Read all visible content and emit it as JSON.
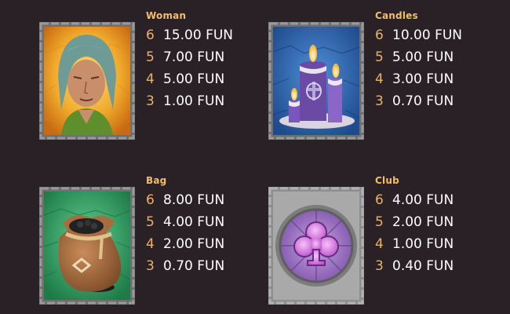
{
  "paytable": {
    "symbols": [
      {
        "name": "Woman",
        "icon": "woman-symbol-icon",
        "payouts": [
          {
            "count": "6",
            "amount": "15.00 FUN"
          },
          {
            "count": "5",
            "amount": "7.00 FUN"
          },
          {
            "count": "4",
            "amount": "5.00 FUN"
          },
          {
            "count": "3",
            "amount": "1.00 FUN"
          }
        ]
      },
      {
        "name": "Candles",
        "icon": "candles-symbol-icon",
        "payouts": [
          {
            "count": "6",
            "amount": "10.00 FUN"
          },
          {
            "count": "5",
            "amount": "5.00 FUN"
          },
          {
            "count": "4",
            "amount": "3.00 FUN"
          },
          {
            "count": "3",
            "amount": "0.70 FUN"
          }
        ]
      },
      {
        "name": "Bag",
        "icon": "bag-symbol-icon",
        "payouts": [
          {
            "count": "6",
            "amount": "8.00 FUN"
          },
          {
            "count": "5",
            "amount": "4.00 FUN"
          },
          {
            "count": "4",
            "amount": "2.00 FUN"
          },
          {
            "count": "3",
            "amount": "0.70 FUN"
          }
        ]
      },
      {
        "name": "Club",
        "icon": "club-symbol-icon",
        "payouts": [
          {
            "count": "6",
            "amount": "4.00 FUN"
          },
          {
            "count": "5",
            "amount": "2.00 FUN"
          },
          {
            "count": "4",
            "amount": "1.00 FUN"
          },
          {
            "count": "3",
            "amount": "0.40 FUN"
          }
        ]
      }
    ]
  },
  "colors": {
    "background": "#2a2127",
    "symbol_name": "#f3bd6a",
    "count": "#eab264",
    "amount": "#ffffff"
  }
}
